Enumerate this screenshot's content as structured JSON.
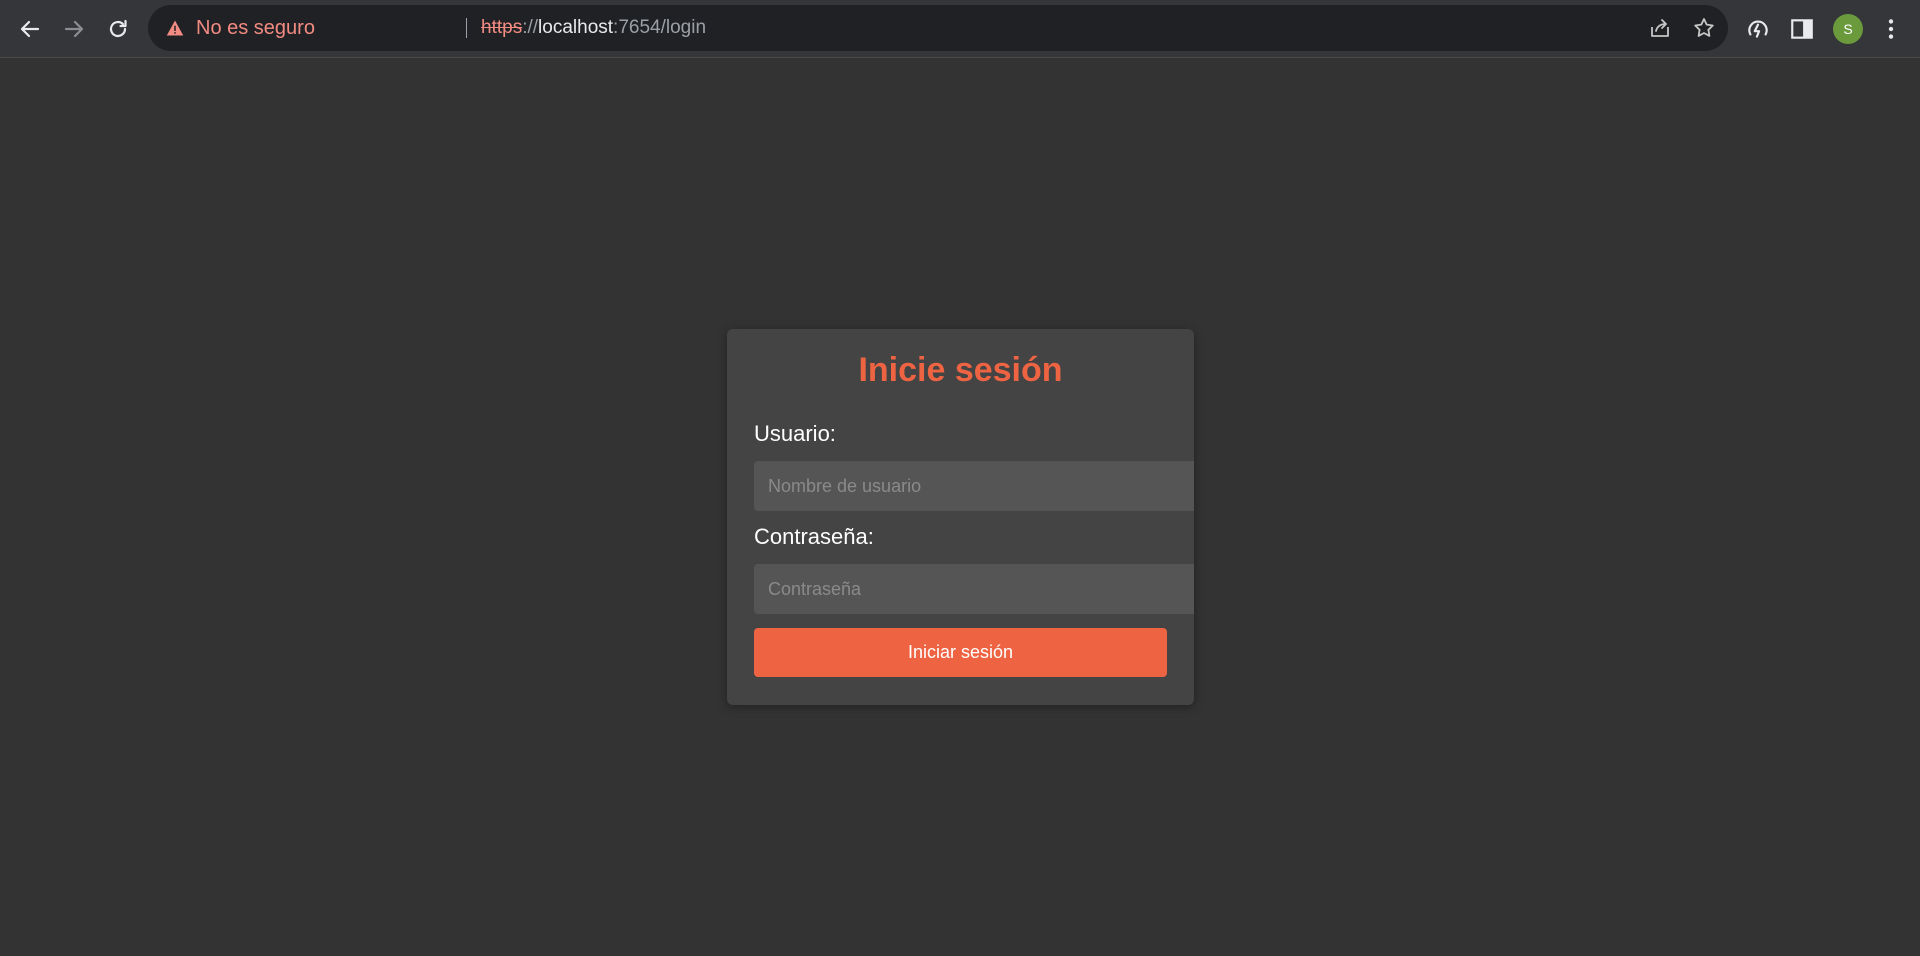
{
  "browser": {
    "security_label": "No es seguro",
    "url_scheme": "https",
    "url_separator": "://",
    "url_host": "localhost",
    "url_rest": ":7654/login",
    "profile_initial": "S",
    "colors": {
      "security_warning": "#f28b82",
      "avatar": "#6a9a3c"
    }
  },
  "login": {
    "title": "Inicie sesión",
    "username_label": "Usuario:",
    "username_placeholder": "Nombre de usuario",
    "password_label": "Contraseña:",
    "password_placeholder": "Contraseña",
    "submit_label": "Iniciar sesión",
    "colors": {
      "accent": "#ee6442",
      "card": "#444444",
      "background": "#333333",
      "input": "#555555"
    }
  }
}
